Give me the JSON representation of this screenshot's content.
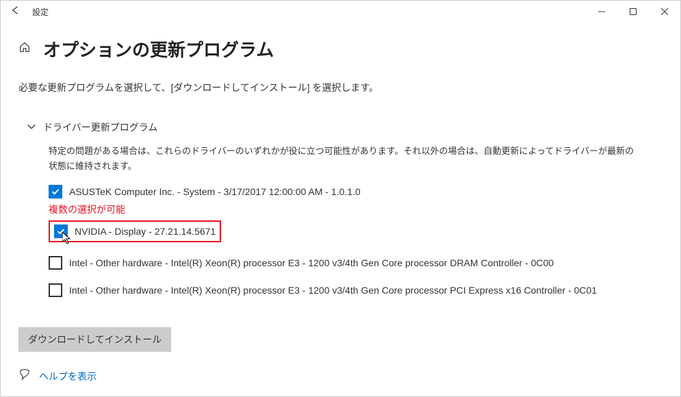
{
  "titlebar": {
    "title": "設定"
  },
  "header": {
    "page_title": "オプションの更新プログラム"
  },
  "subtitle": "必要な更新プログラムを選択して、[ダウンロードしてインストール] を選択します。",
  "section": {
    "title": "ドライバー更新プログラム",
    "description": "特定の問題がある場合は、これらのドライバーのいずれかが役に立つ可能性があります。それ以外の場合は、自動更新によってドライバーが最新の状態に維持されます。"
  },
  "updates": [
    {
      "label": "ASUSTeK Computer Inc. - System - 3/17/2017 12:00:00 AM - 1.0.1.0",
      "checked": true
    },
    {
      "label": "NVIDIA - Display - 27.21.14.5671",
      "checked": true
    },
    {
      "label": "Intel - Other hardware - Intel(R) Xeon(R) processor E3 - 1200 v3/4th Gen Core processor DRAM Controller - 0C00",
      "checked": false
    },
    {
      "label": "Intel - Other hardware - Intel(R) Xeon(R) processor E3 - 1200 v3/4th Gen Core processor PCI Express x16 Controller - 0C01",
      "checked": false
    }
  ],
  "annotation": "複数の選択が可能",
  "download_button": "ダウンロードしてインストール",
  "help": {
    "label": "ヘルプを表示"
  }
}
